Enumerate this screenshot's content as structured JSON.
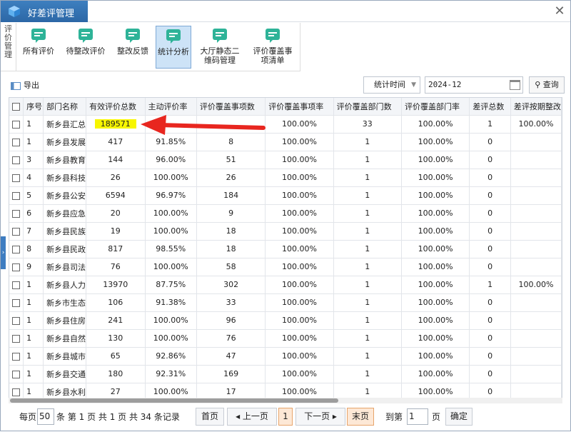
{
  "window": {
    "title": "好差评管理"
  },
  "ribbon": {
    "group_label": [
      "评",
      "价",
      "管",
      "理"
    ],
    "buttons": [
      {
        "label": "所有评价"
      },
      {
        "label": "待整改评价"
      },
      {
        "label": "整改反馈"
      },
      {
        "label": "统计分析"
      },
      {
        "label1": "大厅静态二",
        "label2": "维码管理"
      },
      {
        "label1": "评价覆盖事",
        "label2": "项清单"
      }
    ]
  },
  "toolbar": {
    "export_label": "导出",
    "select_value": "统计时间",
    "date_value": "2024-12",
    "query_label": "查询"
  },
  "table": {
    "headers": [
      "序号",
      "部门名称",
      "有效评价总数",
      "主动评价率",
      "评价覆盖事项数",
      "评价覆盖事项率",
      "评价覆盖部门数",
      "评价覆盖部门率",
      "差评总数",
      "差评按期整改"
    ],
    "rows": [
      [
        "1",
        "新乡县汇总",
        "189571",
        "",
        "",
        "100.00%",
        "33",
        "100.00%",
        "1",
        "100.00%"
      ],
      [
        "1",
        "新乡县发展",
        "417",
        "91.85%",
        "8",
        "100.00%",
        "1",
        "100.00%",
        "0",
        ""
      ],
      [
        "3",
        "新乡县教育",
        "144",
        "96.00%",
        "51",
        "100.00%",
        "1",
        "100.00%",
        "0",
        ""
      ],
      [
        "4",
        "新乡县科技",
        "26",
        "100.00%",
        "26",
        "100.00%",
        "1",
        "100.00%",
        "0",
        ""
      ],
      [
        "5",
        "新乡县公安",
        "6594",
        "96.97%",
        "184",
        "100.00%",
        "1",
        "100.00%",
        "0",
        ""
      ],
      [
        "6",
        "新乡县应急",
        "20",
        "100.00%",
        "9",
        "100.00%",
        "1",
        "100.00%",
        "0",
        ""
      ],
      [
        "7",
        "新乡县民族",
        "19",
        "100.00%",
        "18",
        "100.00%",
        "1",
        "100.00%",
        "0",
        ""
      ],
      [
        "8",
        "新乡县民政",
        "817",
        "98.55%",
        "18",
        "100.00%",
        "1",
        "100.00%",
        "0",
        ""
      ],
      [
        "9",
        "新乡县司法",
        "76",
        "100.00%",
        "58",
        "100.00%",
        "1",
        "100.00%",
        "0",
        ""
      ],
      [
        "1",
        "新乡县人力",
        "13970",
        "87.75%",
        "302",
        "100.00%",
        "1",
        "100.00%",
        "1",
        "100.00%"
      ],
      [
        "1",
        "新乡市生态",
        "106",
        "91.38%",
        "33",
        "100.00%",
        "1",
        "100.00%",
        "0",
        ""
      ],
      [
        "1",
        "新乡县住房",
        "241",
        "100.00%",
        "96",
        "100.00%",
        "1",
        "100.00%",
        "0",
        ""
      ],
      [
        "1",
        "新乡县自然",
        "130",
        "100.00%",
        "76",
        "100.00%",
        "1",
        "100.00%",
        "0",
        ""
      ],
      [
        "1",
        "新乡县城市",
        "65",
        "92.86%",
        "47",
        "100.00%",
        "1",
        "100.00%",
        "0",
        ""
      ],
      [
        "1",
        "新乡县交通",
        "180",
        "92.31%",
        "169",
        "100.00%",
        "1",
        "100.00%",
        "0",
        ""
      ],
      [
        "1",
        "新乡县水利",
        "27",
        "100.00%",
        "17",
        "100.00%",
        "1",
        "100.00%",
        "0",
        ""
      ]
    ]
  },
  "pager": {
    "per_page_prefix": "每页",
    "per_page_value": "50",
    "summary": "条 第 1 页 共 1 页 共 34 条记录",
    "first": "首页",
    "prev": "◂ 上一页",
    "current": "1",
    "next": "下一页 ▸",
    "last": "末页",
    "goto_prefix": "到第",
    "goto_value": "1",
    "goto_suffix": "页",
    "confirm": "确定"
  },
  "colors": {
    "accent": "#2c67a6",
    "highlight": "#f7f600",
    "arrow": "#e8261f"
  }
}
